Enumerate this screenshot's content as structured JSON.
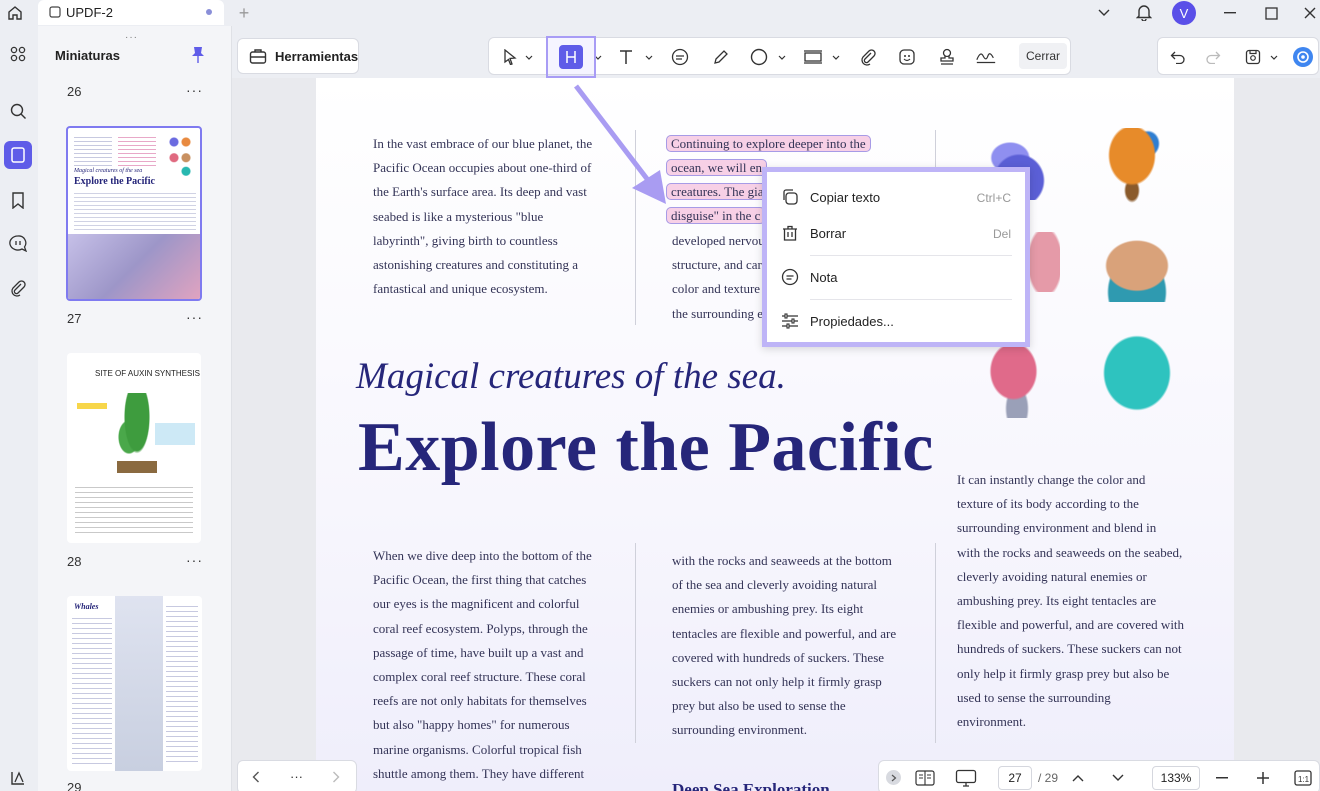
{
  "tab": {
    "title": "UPDF-2"
  },
  "user": {
    "initial": "V"
  },
  "colors": {
    "accent": "#5f5ce8",
    "highlight": "#f7d0e6",
    "title_navy": "#26267a"
  },
  "sidebar": {
    "title": "Miniaturas",
    "pages": [
      {
        "number": "26",
        "caption": "Explore the Pacific"
      },
      {
        "number": "27",
        "caption": "SITE OF AUXIN SYNTHESIS"
      },
      {
        "number": "28",
        "caption": "Whales"
      },
      {
        "number": "29"
      }
    ],
    "more": "···"
  },
  "toolbar": {
    "tools_label": "Herramientas",
    "close_label": "Cerrar"
  },
  "document": {
    "col1_top": [
      "In the vast embrace of our blue planet, the",
      "Pacific Ocean occupies about one-third of",
      "the Earth's surface area. Its deep and vast",
      "seabed is like a mysterious \"blue",
      "labyrinth\", giving birth to countless",
      "astonishing creatures and constituting a",
      "fantastical and unique ecosystem."
    ],
    "col2_top_highlight": [
      "Continuing to explore deeper into the",
      "ocean, we will en",
      "creatures. The gia",
      "disguise\" in the c"
    ],
    "col2_top": [
      "developed nervou",
      "structure, and car",
      "color and texture",
      "the surrounding e"
    ],
    "subtitle": "Magical creatures of the sea.",
    "title": "Explore the Pacific",
    "col3_mid": [
      "It can instantly change the color and",
      "texture of its body according to the",
      "surrounding environment and blend in",
      "with the rocks and seaweeds on the seabed,",
      "cleverly avoiding natural enemies or",
      "ambushing prey. Its eight tentacles are",
      "flexible and powerful, and are covered with",
      "hundreds of suckers. These suckers can not",
      "only help it firmly grasp prey but also be",
      "used to sense the surrounding",
      "environment."
    ],
    "col1_bottom": [
      "When we dive deep into the bottom of the",
      "Pacific Ocean, the first thing that catches",
      "our eyes is the magnificent and colorful",
      "coral reef ecosystem. Polyps, through the",
      "passage of time, have built up a vast and",
      "complex coral reef structure. These coral",
      "reefs are not only habitats for themselves",
      "but also \"happy homes\" for numerous",
      "marine organisms. Colorful tropical fish",
      "shuttle among them. They have different"
    ],
    "col2_bottom": [
      "with the rocks and seaweeds at the bottom",
      "of the sea and cleverly avoiding natural",
      "enemies or ambushing prey. Its eight",
      "tentacles are flexible and powerful, and are",
      "covered with hundreds of suckers. These",
      "suckers can not only help it firmly grasp",
      "prey but also be used to sense the",
      "surrounding environment."
    ],
    "col2_bottom_heading": "Deep Sea Exploration"
  },
  "context_menu": {
    "items": [
      {
        "label": "Copiar texto",
        "shortcut": "Ctrl+C",
        "icon": "copy-icon"
      },
      {
        "label": "Borrar",
        "shortcut": "Del",
        "icon": "trash-icon"
      },
      {
        "label": "Nota",
        "shortcut": "",
        "icon": "note-icon"
      },
      {
        "label": "Propiedades...",
        "shortcut": "",
        "icon": "sliders-icon"
      }
    ]
  },
  "statusbar": {
    "current_page": "27",
    "total_pages": "/ 29",
    "zoom": "133%",
    "more": "···"
  }
}
